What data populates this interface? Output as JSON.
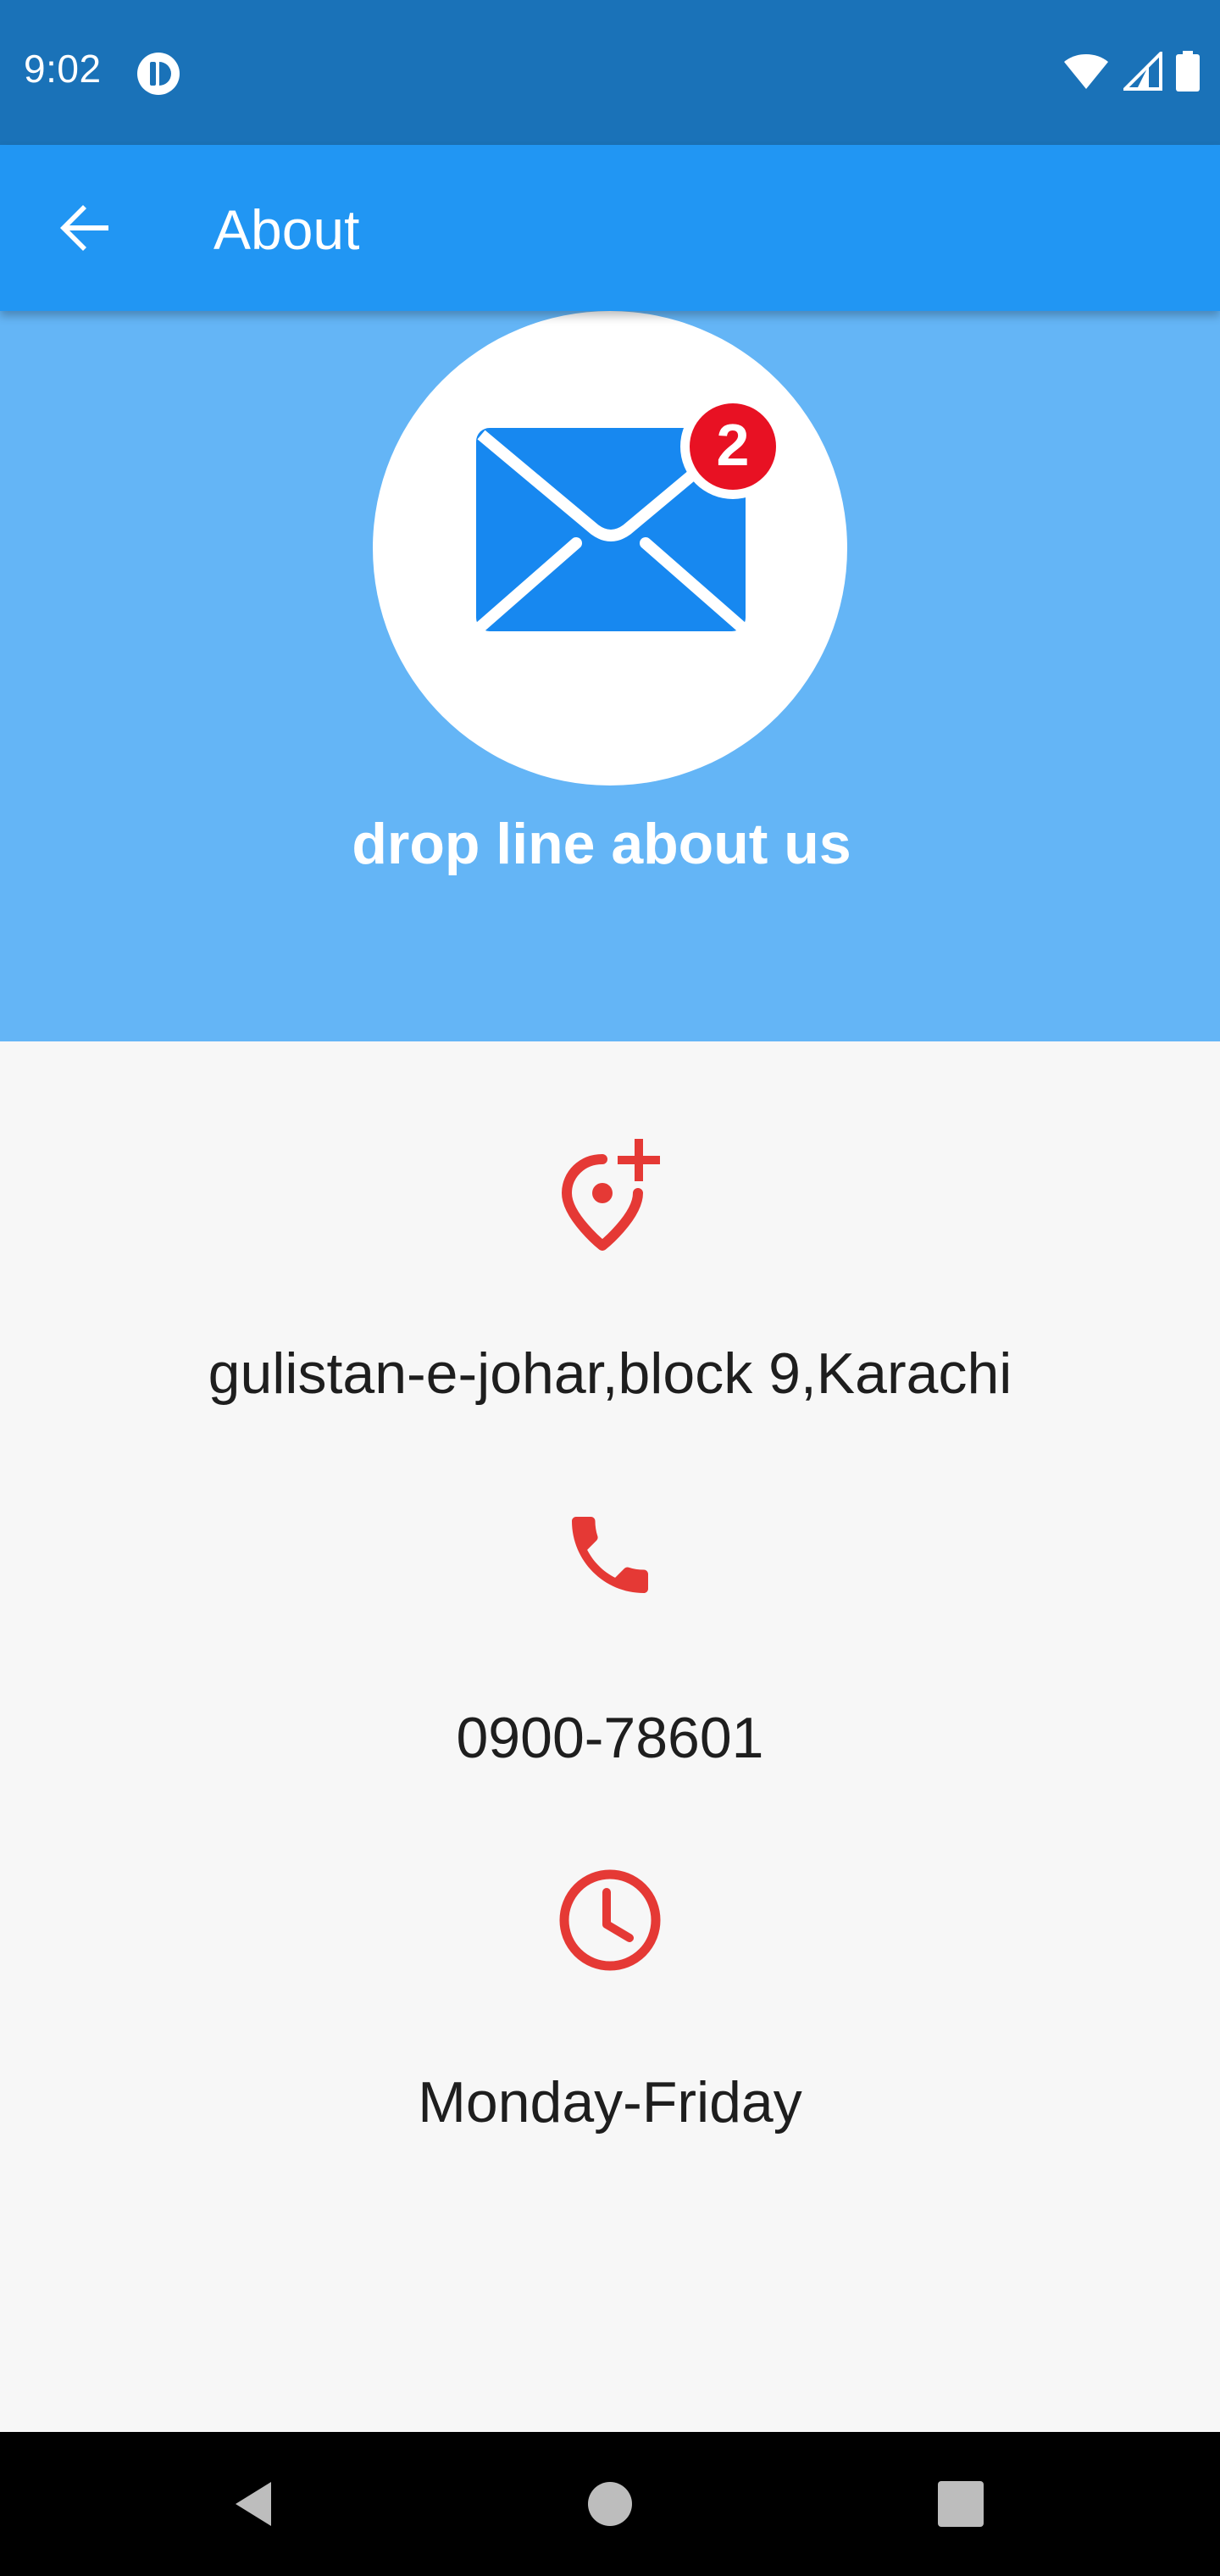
{
  "status_bar": {
    "time": "9:02",
    "icons": [
      "app-notification-icon",
      "wifi-icon",
      "signal-icon",
      "battery-icon"
    ]
  },
  "app_bar": {
    "title": "About",
    "back_icon": "arrow-back-icon"
  },
  "header": {
    "logo_icon": "mail-icon",
    "badge_count": "2",
    "caption": "drop line about us",
    "background_color": "#64b5f6"
  },
  "info": [
    {
      "icon": "add-location-icon",
      "text": "gulistan-e-johar,block 9,Karachi"
    },
    {
      "icon": "phone-icon",
      "text": "0900-78601"
    },
    {
      "icon": "clock-icon",
      "text": "Monday-Friday"
    }
  ],
  "nav_bar": {
    "buttons": [
      "back-triangle-icon",
      "home-circle-icon",
      "recents-square-icon"
    ]
  },
  "colors": {
    "status_bar": "#1a72b8",
    "app_bar": "#2196f3",
    "accent_red": "#e53935",
    "badge_red": "#e81123",
    "mail_blue": "#1788f0"
  }
}
